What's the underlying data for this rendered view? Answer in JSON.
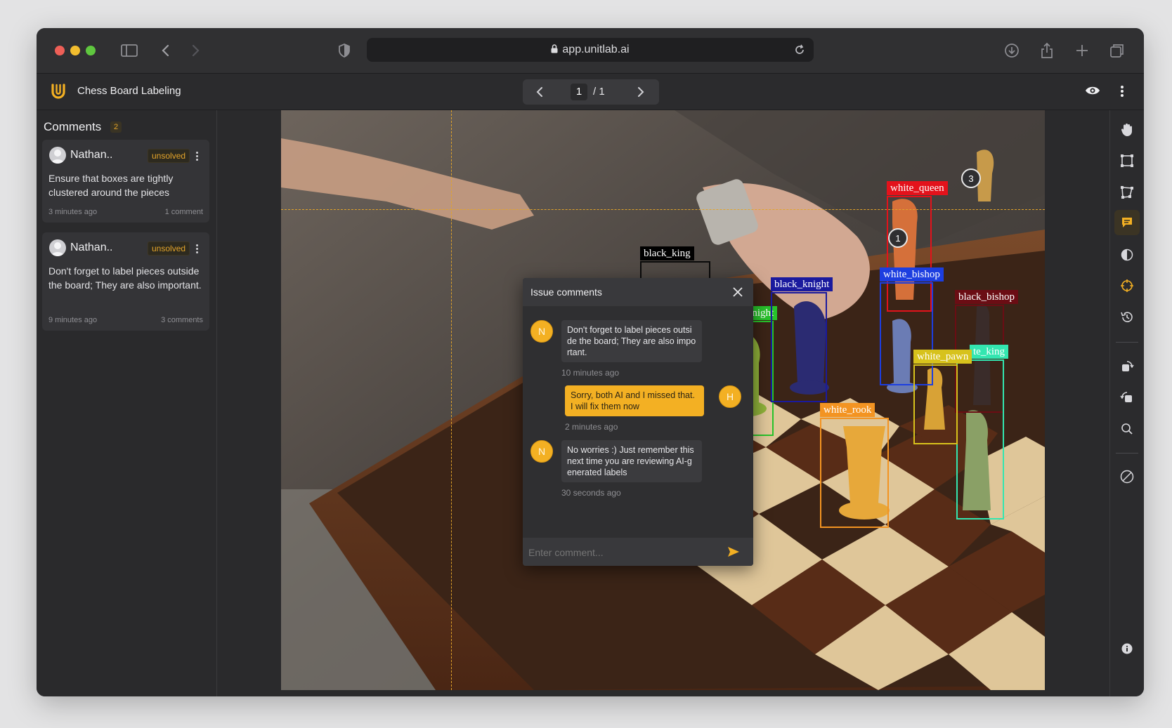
{
  "browser": {
    "url": "app.unitlab.ai",
    "traffic_colors": [
      "#ee5f57",
      "#f2bd2f",
      "#5fc73f"
    ]
  },
  "app": {
    "title": "Chess Board Labeling",
    "page_current": "1",
    "page_total": "/ 1",
    "accent": "#f3b023"
  },
  "comments": {
    "title": "Comments",
    "count": "2",
    "items": [
      {
        "author": "Nathan..",
        "status": "unsolved",
        "text": "Ensure that boxes are tightly clustered around the pieces",
        "time": "3 minutes ago",
        "replies": "1 comment"
      },
      {
        "author": "Nathan..",
        "status": "unsolved",
        "text": "Don't forget to label pieces outside the board; They are also important.",
        "time": "9 minutes ago",
        "replies": "3 comments"
      }
    ]
  },
  "issue": {
    "title": "Issue comments",
    "messages": [
      {
        "avatar": "N",
        "text": "Don't forget to label pieces outsi de the board; They are also impo rtant.",
        "time": "10 minutes ago"
      },
      {
        "avatar": "H",
        "text": "Sorry, both AI and I missed that. I will fix them now",
        "time": "2 minutes ago"
      },
      {
        "avatar": "N",
        "text": "No worries :) Just remember this next time you are reviewing AI-g enerated labels",
        "time": "30 seconds ago"
      }
    ],
    "input_placeholder": "Enter comment..."
  },
  "annotations": [
    {
      "label": "black_king",
      "color": "#000000"
    },
    {
      "label": "white_knight",
      "color": "#28c22b"
    },
    {
      "label": "black_knight",
      "color": "#1a1a9e"
    },
    {
      "label": "white_queen",
      "color": "#e3121b"
    },
    {
      "label": "white_bishop",
      "color": "#1c3ee0"
    },
    {
      "label": "black_bishop",
      "color": "#6b0d14"
    },
    {
      "label": "white_pawn",
      "color": "#d7c21c"
    },
    {
      "label": "te_king",
      "color": "#33e6b0"
    },
    {
      "label": "white_rook",
      "color": "#f39422"
    }
  ],
  "markers": [
    "3",
    "1"
  ]
}
